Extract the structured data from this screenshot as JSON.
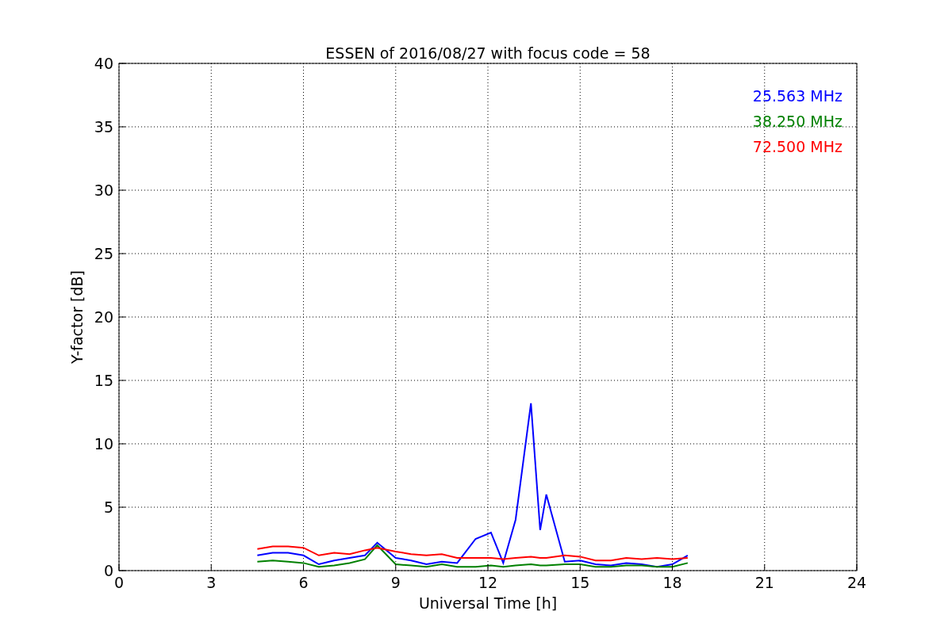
{
  "chart_data": {
    "type": "line",
    "title": "ESSEN of 2016/08/27 with focus code = 58",
    "xlabel": "Universal Time [h]",
    "ylabel": "Y-factor [dB]",
    "grid": true,
    "xlim": [
      0,
      24
    ],
    "ylim": [
      0,
      40
    ],
    "xticks": [
      0,
      3,
      6,
      9,
      12,
      15,
      18,
      21,
      24
    ],
    "yticks": [
      0,
      5,
      10,
      15,
      20,
      25,
      30,
      35,
      40
    ],
    "x": [
      4.5,
      5,
      5.5,
      6,
      6.5,
      7,
      7.5,
      8,
      8.4,
      9,
      9.5,
      10,
      10.5,
      11,
      11.6,
      12.1,
      12.5,
      12.9,
      13.4,
      13.7,
      13.9,
      14.5,
      15,
      15.5,
      16,
      16.5,
      17,
      17.5,
      18,
      18.5
    ],
    "series": [
      {
        "name": "25.563 MHz",
        "color": "#0000ff",
        "values": [
          1.2,
          1.4,
          1.4,
          1.2,
          0.5,
          0.8,
          1.0,
          1.2,
          2.2,
          1.0,
          0.8,
          0.5,
          0.7,
          0.6,
          2.5,
          3.0,
          0.6,
          4.0,
          13.2,
          3.2,
          6.0,
          0.7,
          0.8,
          0.5,
          0.4,
          0.6,
          0.5,
          0.3,
          0.5,
          1.2
        ]
      },
      {
        "name": "38.250 MHz",
        "color": "#008000",
        "values": [
          0.7,
          0.8,
          0.7,
          0.6,
          0.3,
          0.4,
          0.6,
          0.9,
          2.0,
          0.5,
          0.4,
          0.3,
          0.5,
          0.3,
          0.3,
          0.4,
          0.3,
          0.4,
          0.5,
          0.4,
          0.4,
          0.5,
          0.5,
          0.3,
          0.3,
          0.4,
          0.4,
          0.3,
          0.3,
          0.6
        ]
      },
      {
        "name": "72.500 MHz",
        "color": "#ff0000",
        "values": [
          1.7,
          1.9,
          1.9,
          1.8,
          1.2,
          1.4,
          1.3,
          1.6,
          1.8,
          1.5,
          1.3,
          1.2,
          1.3,
          1.0,
          1.0,
          1.0,
          0.9,
          1.0,
          1.1,
          1.0,
          1.0,
          1.2,
          1.1,
          0.8,
          0.8,
          1.0,
          0.9,
          1.0,
          0.9,
          1.0
        ]
      }
    ]
  }
}
